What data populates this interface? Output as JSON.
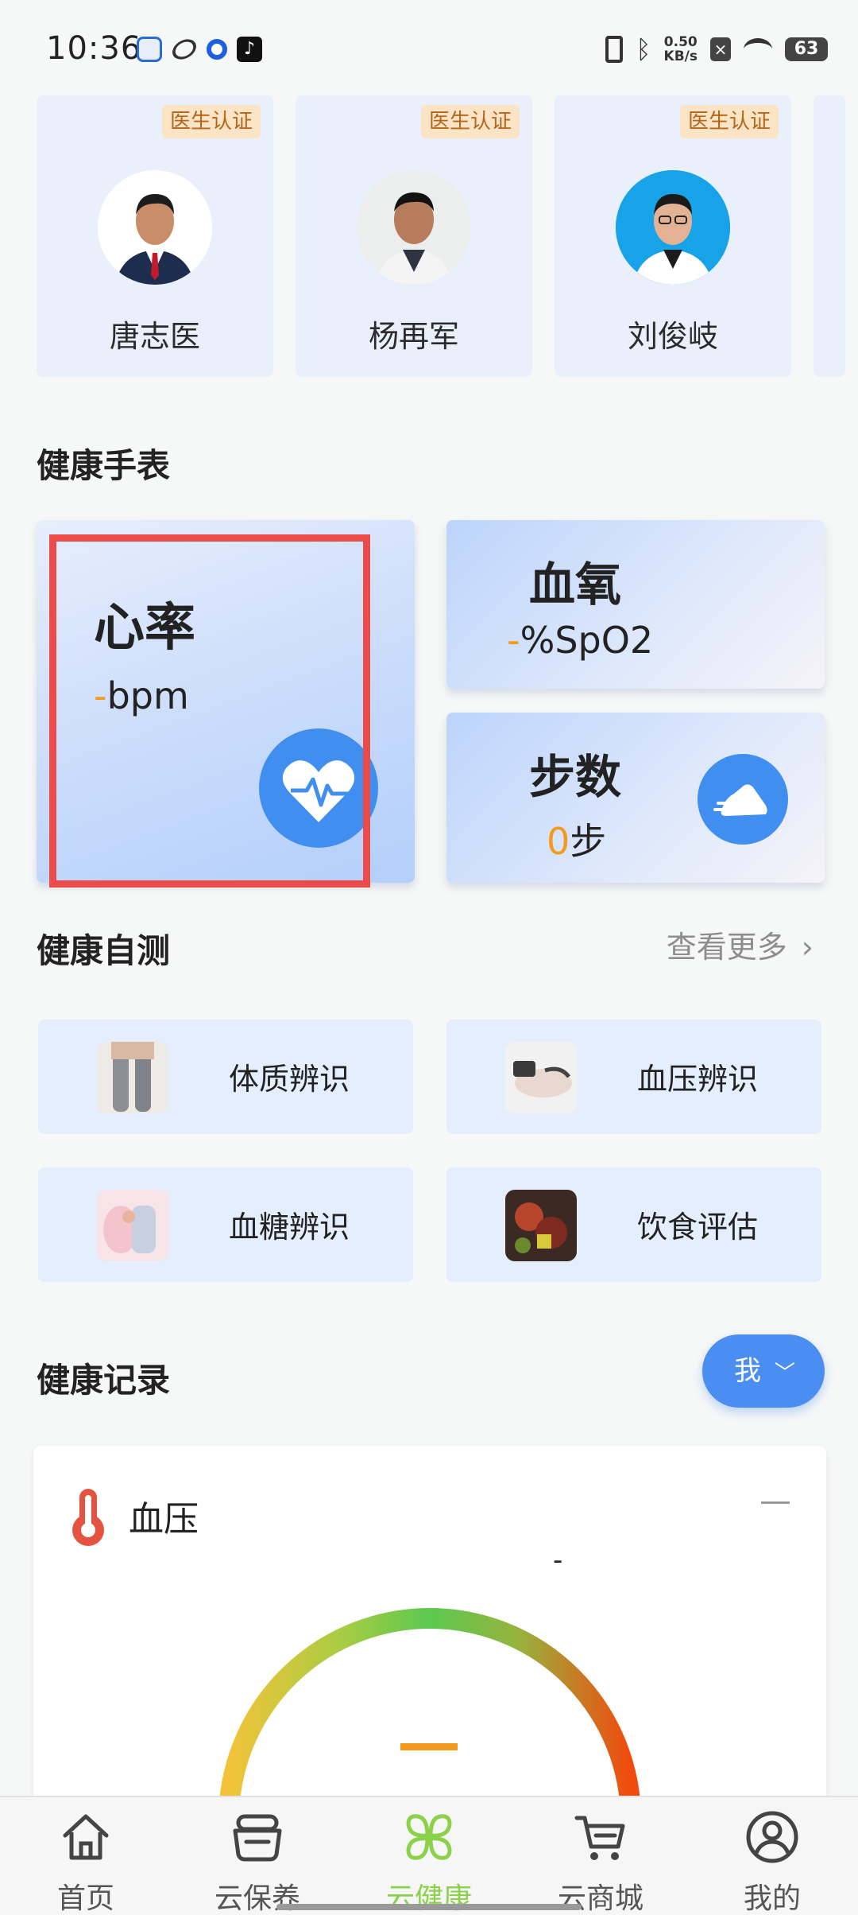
{
  "status_bar": {
    "time": "10:36",
    "net_speed_value": "0.50",
    "net_speed_unit": "KB/s",
    "battery": "63"
  },
  "doctors": [
    {
      "name": "唐志医",
      "badge": "医生认证"
    },
    {
      "name": "杨再军",
      "badge": "医生认证"
    },
    {
      "name": "刘俊岐",
      "badge": "医生认证"
    }
  ],
  "watch": {
    "section_title": "健康手表",
    "heart_rate": {
      "title": "心率",
      "value": "-",
      "unit": "bpm"
    },
    "oxygen": {
      "title": "血氧",
      "value": "-",
      "unit": "%SpO2"
    },
    "steps": {
      "title": "步数",
      "value": "0",
      "unit": "步"
    }
  },
  "self_test": {
    "section_title": "健康自测",
    "more_label": "查看更多",
    "items": [
      {
        "label": "体质辨识",
        "icon": "body-type-photo"
      },
      {
        "label": "血压辨识",
        "icon": "blood-pressure-photo"
      },
      {
        "label": "血糖辨识",
        "icon": "blood-sugar-photo"
      },
      {
        "label": "饮食评估",
        "icon": "diet-photo"
      }
    ]
  },
  "records": {
    "section_title": "健康记录",
    "me_button": "我",
    "card_title": "血压",
    "top_value": "-"
  },
  "nav": {
    "items": [
      {
        "label": "首页",
        "icon": "home-icon"
      },
      {
        "label": "云保养",
        "icon": "bowl-icon"
      },
      {
        "label": "云健康",
        "icon": "clover-icon",
        "active": true
      },
      {
        "label": "云商城",
        "icon": "cart-icon"
      },
      {
        "label": "我的",
        "icon": "profile-icon"
      }
    ]
  },
  "colors": {
    "accent_blue": "#3f8ef0",
    "active_green": "#8bd24a",
    "value_orange": "#f39a1c",
    "highlight_red": "#ea4c4c"
  }
}
